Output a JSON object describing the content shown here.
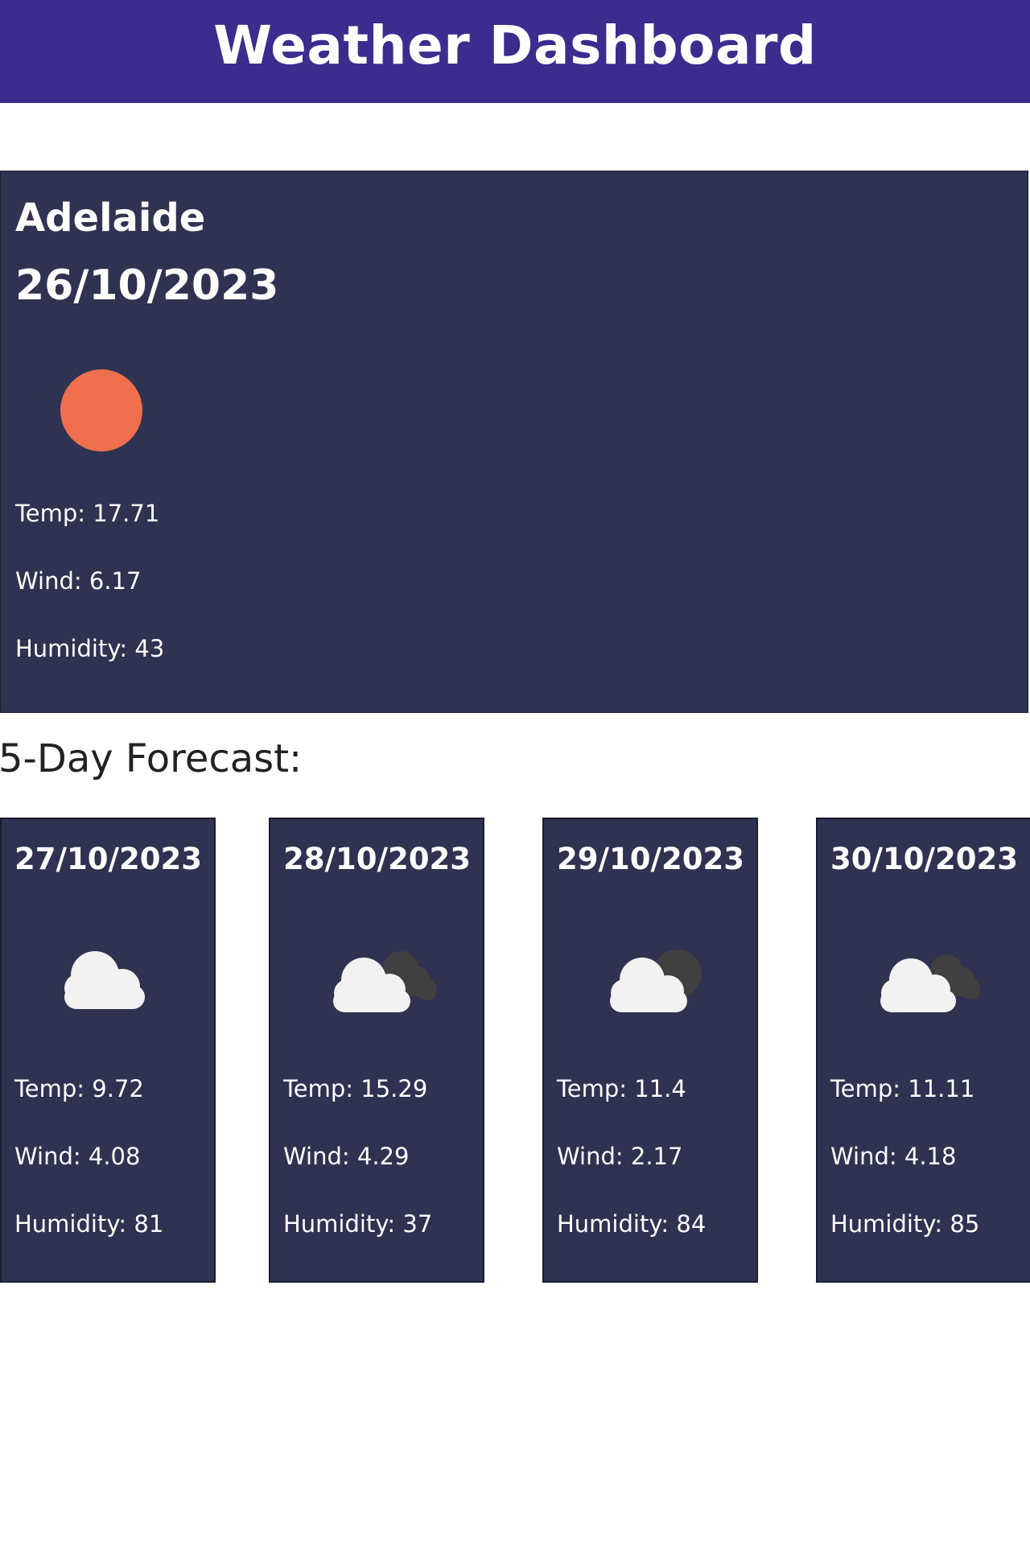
{
  "header": {
    "title": "Weather Dashboard",
    "bg_color": "#3a2d8e"
  },
  "current": {
    "city": "Adelaide",
    "date": "26/10/2023",
    "icon": "sun-icon",
    "temp": "Temp: 17.71",
    "wind": "Wind: 6.17",
    "humidity": "Humidity: 43"
  },
  "forecast": {
    "title": "5-Day Forecast:",
    "days": [
      {
        "date": "27/10/2023",
        "icon": "cloud-icon",
        "temp": "Temp: 9.72",
        "wind": "Wind: 4.08",
        "humidity": "Humidity: 81"
      },
      {
        "date": "28/10/2023",
        "icon": "broken-clouds-icon",
        "temp": "Temp: 15.29",
        "wind": "Wind: 4.29",
        "humidity": "Humidity: 37"
      },
      {
        "date": "29/10/2023",
        "icon": "cloud-with-dark-sun-icon",
        "temp": "Temp: 11.4",
        "wind": "Wind: 2.17",
        "humidity": "Humidity: 84"
      },
      {
        "date": "30/10/2023",
        "icon": "broken-clouds-icon",
        "temp": "Temp: 11.11",
        "wind": "Wind: 4.18",
        "humidity": "Humidity: 85"
      }
    ]
  },
  "colors": {
    "card_bg": "#2f3250",
    "sun": "#ee6e4e",
    "cloud": "#f2f2f2",
    "dark_cloud": "#404040"
  }
}
